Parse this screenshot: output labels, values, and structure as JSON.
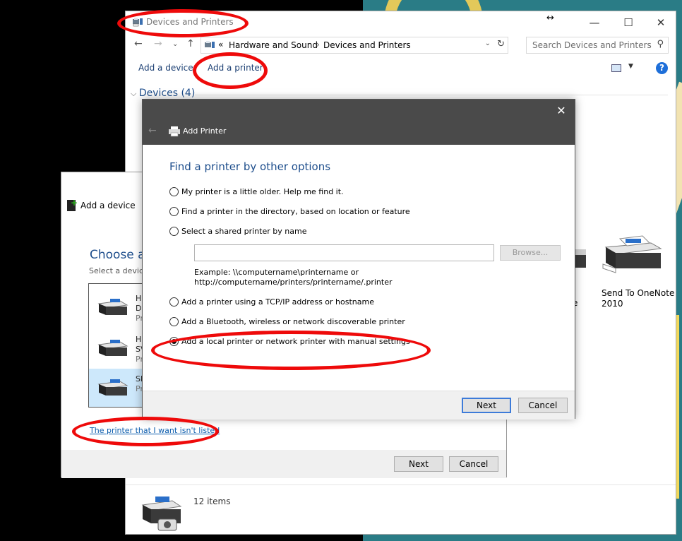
{
  "devices_window": {
    "title": "Devices and Printers",
    "breadcrumb": [
      "Hardware and Sound",
      "Devices and Printers"
    ],
    "breadcrumb_prefix": "«",
    "search_placeholder": "Search Devices and Printers",
    "toolbar": {
      "add_device": "Add a device",
      "add_printer": "Add a printer"
    },
    "devices_section": "Devices (4)",
    "printer_label": "Send To OneNote 2010",
    "partial_label": "e",
    "status_items": "12 items"
  },
  "add_device_window": {
    "title": "Add a device",
    "heading": "Choose a",
    "subtitle": "Select a device",
    "items": [
      {
        "l1": "HI",
        "l2": "De",
        "l3": "Pr"
      },
      {
        "l1": "HI",
        "l2": "SV",
        "l3": "Pr"
      },
      {
        "l1": "SH",
        "l2": "",
        "l3": "Pr"
      }
    ],
    "link": "The printer that I want isn't listed",
    "next": "Next",
    "cancel": "Cancel"
  },
  "add_printer_dialog": {
    "title": "Add Printer",
    "heading": "Find a printer by other options",
    "options": [
      {
        "label": "My printer is a little older. Help me find it.",
        "checked": false
      },
      {
        "label": "Find a printer in the directory, based on location or feature",
        "checked": false
      },
      {
        "label": "Select a shared printer by name",
        "checked": false
      },
      {
        "label": "Add a printer using a TCP/IP address or hostname",
        "checked": false
      },
      {
        "label": "Add a Bluetooth, wireless or network discoverable printer",
        "checked": false
      },
      {
        "label": "Add a local printer or network printer with manual settings",
        "checked": true
      }
    ],
    "shared_printer_value": "",
    "browse": "Browse...",
    "example_line1": "Example: \\\\computername\\printername or",
    "example_line2": "http://computername/printers/printername/.printer",
    "next": "Next",
    "cancel": "Cancel"
  },
  "annotation_color": "#ee0a0a"
}
